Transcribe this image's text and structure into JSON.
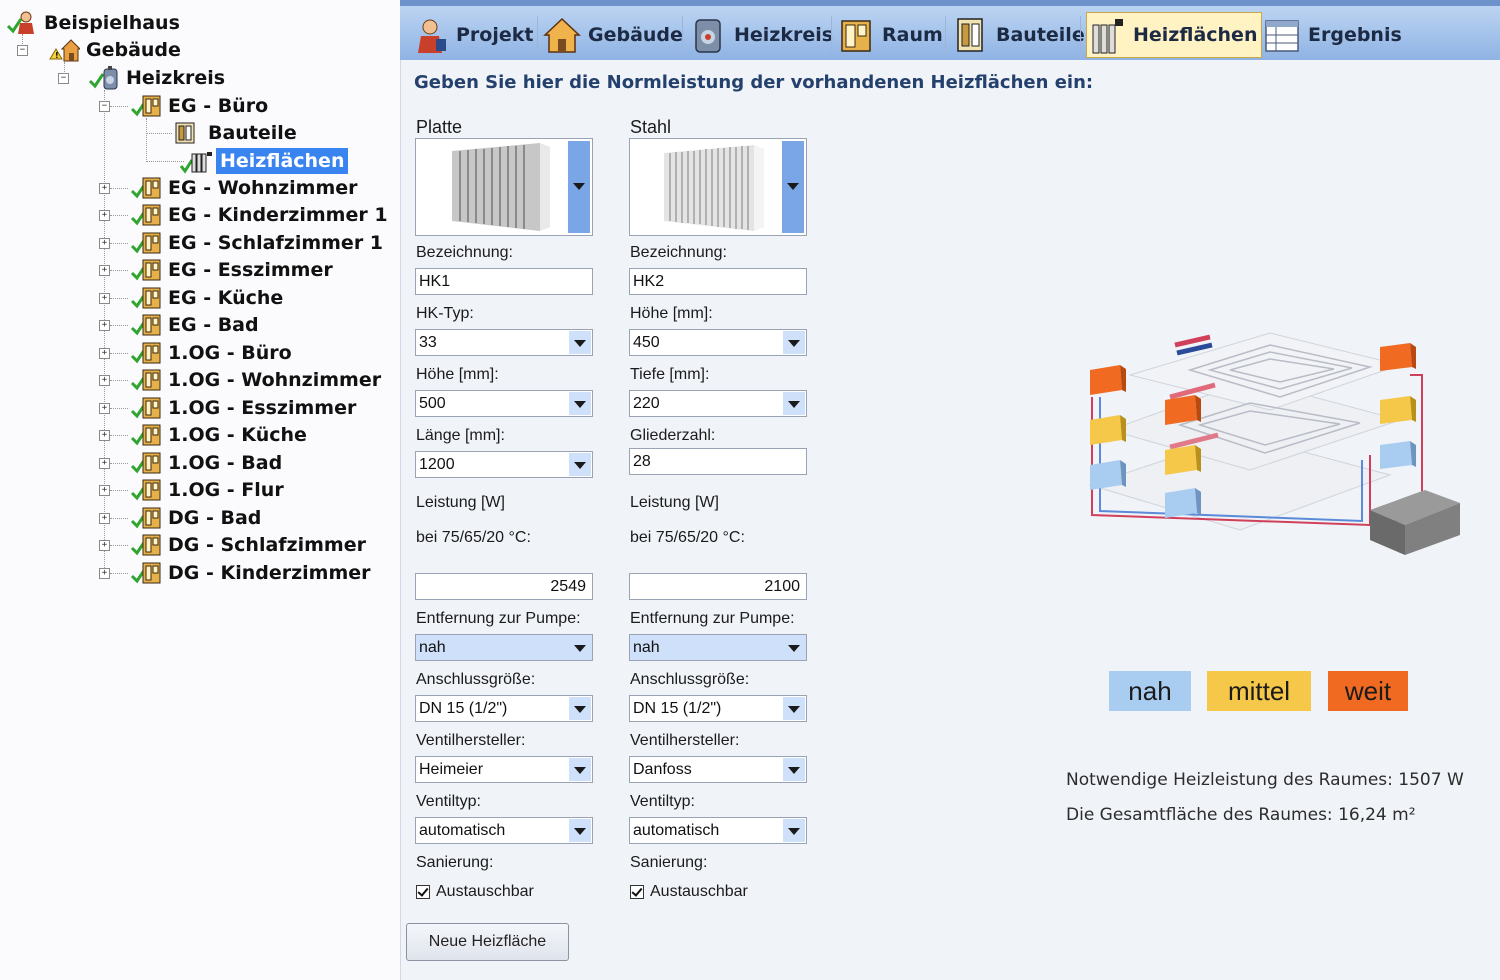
{
  "tree": {
    "root": "Beispielhaus",
    "building": "Gebäude",
    "circuit": "Heizkreis",
    "rooms": [
      "EG - Büro",
      "EG - Wohnzimmer",
      "EG - Kinderzimmer 1",
      "EG - Schlafzimmer 1",
      "EG - Esszimmer",
      "EG - Küche",
      "EG - Bad",
      "1.OG - Büro",
      "1.OG - Wohnzimmer",
      "1.OG - Esszimmer",
      "1.OG - Küche",
      "1.OG - Bad",
      "1.OG - Flur",
      "DG - Bad",
      "DG - Schlafzimmer",
      "DG - Kinderzimmer"
    ],
    "sub_items": [
      "Bauteile",
      "Heizflächen"
    ]
  },
  "toolbar": {
    "tabs": [
      "Projekt",
      "Gebäude",
      "Heizkreis",
      "Raum",
      "Bauteile",
      "Heizflächen",
      "Ergebnis"
    ],
    "active": "Heizflächen"
  },
  "heading": "Geben Sie hier die Normleistung der vorhandenen Heizflächen ein:",
  "radiators": [
    {
      "type": "Platte",
      "bezeichnung_label": "Bezeichnung:",
      "bezeichnung": "HK1",
      "f1_label": "HK-Typ:",
      "f1": "33",
      "f2_label": "Höhe [mm]:",
      "f2": "500",
      "f3_label": "Länge [mm]:",
      "f3": "1200",
      "leistung_label": "Leistung [W]",
      "bei_label": "bei 75/65/20 °C:",
      "leistung": "2549",
      "pumpe_label": "Entfernung zur Pumpe:",
      "pumpe": "nah",
      "anschluss_label": "Anschlussgröße:",
      "anschluss": "DN 15 (1/2\")",
      "hersteller_label": "Ventilhersteller:",
      "hersteller": "Heimeier",
      "ventiltyp_label": "Ventiltyp:",
      "ventiltyp": "automatisch",
      "sanierung_label": "Sanierung:",
      "austausch_label": "Austauschbar"
    },
    {
      "type": "Stahl",
      "bezeichnung_label": "Bezeichnung:",
      "bezeichnung": "HK2",
      "f1_label": "Höhe [mm]:",
      "f1": "450",
      "f2_label": "Tiefe [mm]:",
      "f2": "220",
      "f3_label": "Gliederzahl:",
      "f3": "28",
      "leistung_label": "Leistung [W]",
      "bei_label": "bei 75/65/20 °C:",
      "leistung": "2100",
      "pumpe_label": "Entfernung zur Pumpe:",
      "pumpe": "nah",
      "anschluss_label": "Anschlussgröße:",
      "anschluss": "DN 15 (1/2\")",
      "hersteller_label": "Ventilhersteller:",
      "hersteller": "Danfoss",
      "ventiltyp_label": "Ventiltyp:",
      "ventiltyp": "automatisch",
      "sanierung_label": "Sanierung:",
      "austausch_label": "Austauschbar"
    }
  ],
  "new_button": "Neue Heizfläche",
  "legend": [
    {
      "label": "nah",
      "color": "#a9cdf0"
    },
    {
      "label": "mittel",
      "color": "#f5c84a"
    },
    {
      "label": "weit",
      "color": "#f06a22"
    }
  ],
  "info": {
    "line1": "Notwendige Heizleistung des Raumes: 1507 W",
    "line2": "Die Gesamtfläche des Raumes: 16,24 m²"
  },
  "colors": {
    "accent": "#3a84f0",
    "toolbar": "#8fb3e4",
    "active_tab": "#fff3c4",
    "check": "#2fa52f"
  },
  "icons": [
    "person-icon",
    "house-icon",
    "boiler-icon",
    "room-door-icon",
    "components-icon",
    "radiator-icon",
    "table-icon",
    "checkmark-icon",
    "warning-icon"
  ]
}
